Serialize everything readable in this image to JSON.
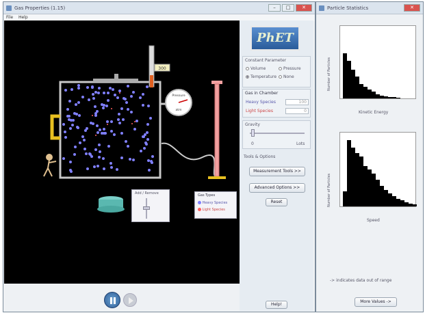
{
  "main_window": {
    "title": "Gas Properties (1.15)",
    "menu": [
      "File",
      "Help"
    ]
  },
  "logo": {
    "text": "PhET"
  },
  "constant_params": {
    "title": "Constant Parameter",
    "options": [
      {
        "label": "Volume",
        "selected": false
      },
      {
        "label": "Pressure",
        "selected": false
      },
      {
        "label": "Temperature",
        "selected": true
      },
      {
        "label": "None",
        "selected": false
      }
    ]
  },
  "gas_in_chamber": {
    "title": "Gas in Chamber",
    "heavy": {
      "label": "Heavy Species",
      "value": "100"
    },
    "light": {
      "label": "Light Species",
      "value": "0"
    }
  },
  "gravity": {
    "title": "Gravity",
    "min_label": "0",
    "max_label": "Lots"
  },
  "tools": {
    "title": "Tools & Options",
    "measurement_button": "Measurement Tools >>",
    "advanced_button": "Advanced Options >>",
    "reset_button": "Reset"
  },
  "heat_control": {
    "label": "Add / Remove"
  },
  "gauge": {
    "label": "Pressure",
    "unit": "atm"
  },
  "thermometer": {
    "value": "300"
  },
  "legend": {
    "title": "Gas Types",
    "items": [
      {
        "label": "Heavy Species",
        "color": "#8080ff"
      },
      {
        "label": "Light Species",
        "color": "#ff6060"
      }
    ]
  },
  "help_button": "Help!",
  "play": {
    "pause_label": "pause",
    "step_label": "step"
  },
  "stats_window": {
    "title": "Particle Statistics",
    "energy": {
      "ylabel": "Number of Particles",
      "xlabel": "Kinetic Energy"
    },
    "speed": {
      "ylabel": "Number of Particles",
      "xlabel": "Speed"
    },
    "out_of_range_note": "-> indicates data out of range",
    "more_button": "More Values ->"
  },
  "colors": {
    "sim_bg": "#000000",
    "pump": "#f2a0a0",
    "heavy": "#8080ff",
    "light": "#ff6060"
  }
}
